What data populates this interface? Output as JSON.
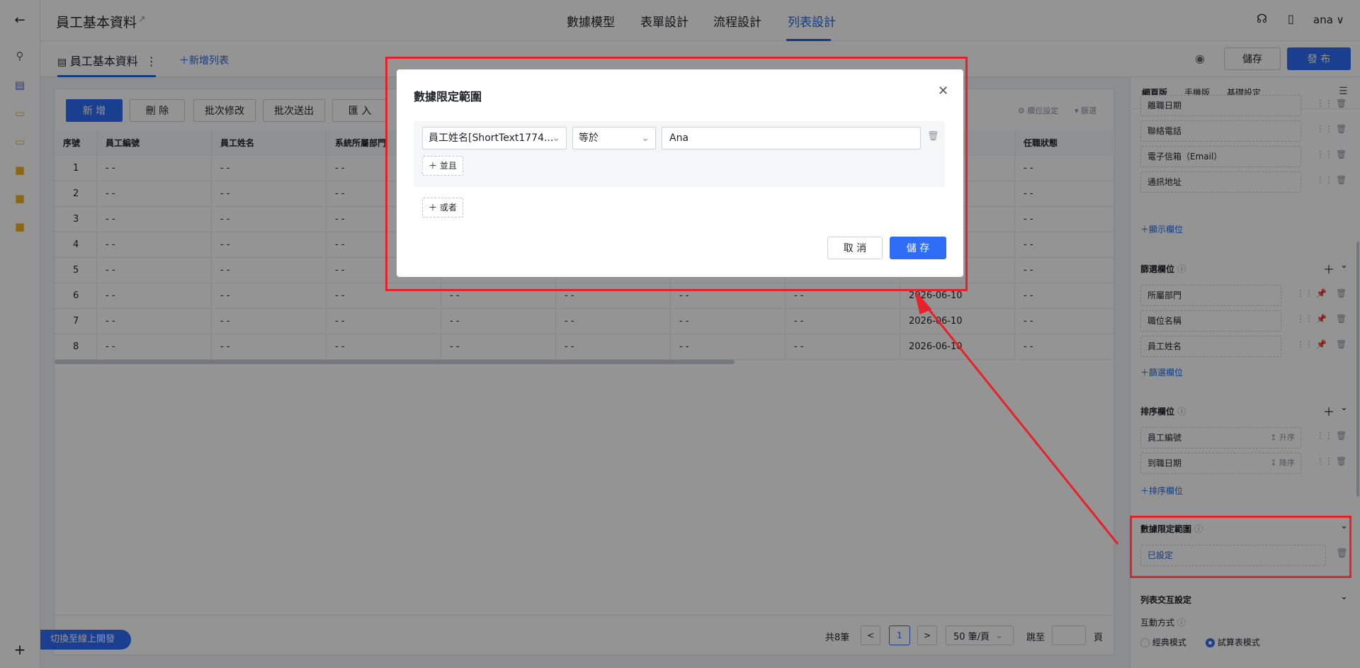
{
  "rail": {
    "back_icon": "arrow-left-icon",
    "icons": [
      "search-icon",
      "table-icon",
      "form-icon",
      "form-icon",
      "folder-icon",
      "folder-icon",
      "folder-icon"
    ],
    "plus": "+"
  },
  "header": {
    "title": "員工基本資料",
    "tabs": [
      "數據模型",
      "表單設計",
      "流程設計",
      "列表設計"
    ],
    "active_tab": "列表設計",
    "user": "ana ∨"
  },
  "subbar": {
    "list_name": "員工基本資料",
    "more": "⋮",
    "add_list": "＋新增列表",
    "save": "儲存",
    "publish": "發 布"
  },
  "toolbar": {
    "add": "新 增",
    "delete": "刪 除",
    "batch_edit": "批次修改",
    "batch_export": "批次送出",
    "import": "匯 入",
    "column_settings": "欄位設定",
    "filter": "篩選"
  },
  "table": {
    "headers": [
      "序號",
      "員工編號",
      "員工姓名",
      "系統所屬部門",
      "",
      "",
      "",
      "",
      "",
      "任職狀態"
    ],
    "rows": [
      [
        "1",
        "- -",
        "- -",
        "- -",
        "",
        "",
        "",
        "",
        "",
        "- -"
      ],
      [
        "2",
        "- -",
        "- -",
        "- -",
        "",
        "",
        "",
        "",
        "",
        "- -"
      ],
      [
        "3",
        "- -",
        "- -",
        "- -",
        "",
        "",
        "",
        "",
        "",
        "- -"
      ],
      [
        "4",
        "- -",
        "- -",
        "- -",
        "",
        "",
        "",
        "",
        "",
        "- -"
      ],
      [
        "5",
        "- -",
        "- -",
        "- -",
        "",
        "",
        "",
        "",
        "",
        "- -"
      ],
      [
        "6",
        "- -",
        "- -",
        "- -",
        "- -",
        "- -",
        "- -",
        "- -",
        "2026-06-10",
        "- -"
      ],
      [
        "7",
        "- -",
        "- -",
        "- -",
        "- -",
        "- -",
        "- -",
        "- -",
        "2026-06-10",
        "- -"
      ],
      [
        "8",
        "- -",
        "- -",
        "- -",
        "- -",
        "- -",
        "- -",
        "- -",
        "2026-06-10",
        "- -"
      ]
    ]
  },
  "pager": {
    "total": "共8筆",
    "page": "1",
    "page_size": "50 筆/頁",
    "jump_to": "跳至",
    "page_unit": "頁",
    "prev": "<",
    "next": ">"
  },
  "right_panel": {
    "tabs": [
      "網頁版",
      "手機版",
      "基礎設定"
    ],
    "display_fields": [
      "離職日期",
      "聯絡電話",
      "電子信箱（Email）",
      "通訊地址"
    ],
    "add_display": "＋顯示欄位",
    "filter_title": "篩選欄位",
    "filter_fields": [
      "所屬部門",
      "職位名稱",
      "員工姓名"
    ],
    "add_filter": "＋篩選欄位",
    "sort_title": "排序欄位",
    "sort_fields": [
      {
        "name": "員工編號",
        "order": "↥ 升序"
      },
      {
        "name": "到職日期",
        "order": "↧ 降序"
      }
    ],
    "add_sort": "＋排序欄位",
    "scope_title": "數據限定範圍",
    "scope_value": "已設定",
    "interaction_title": "列表交互設定",
    "interaction_mode": "互動方式",
    "modes": [
      "經典模式",
      "試算表模式"
    ]
  },
  "modal": {
    "title": "數據限定範圍",
    "field": "員工姓名[ShortText1774...",
    "operator": "等於",
    "value": "Ana",
    "and": "＋ 並且",
    "or": "＋ 或者",
    "cancel": "取 消",
    "save": "儲 存"
  },
  "bottom_button": "切換至線上開發",
  "colors": {
    "primary": "#2f6df6",
    "annotation": "#e8202a"
  }
}
